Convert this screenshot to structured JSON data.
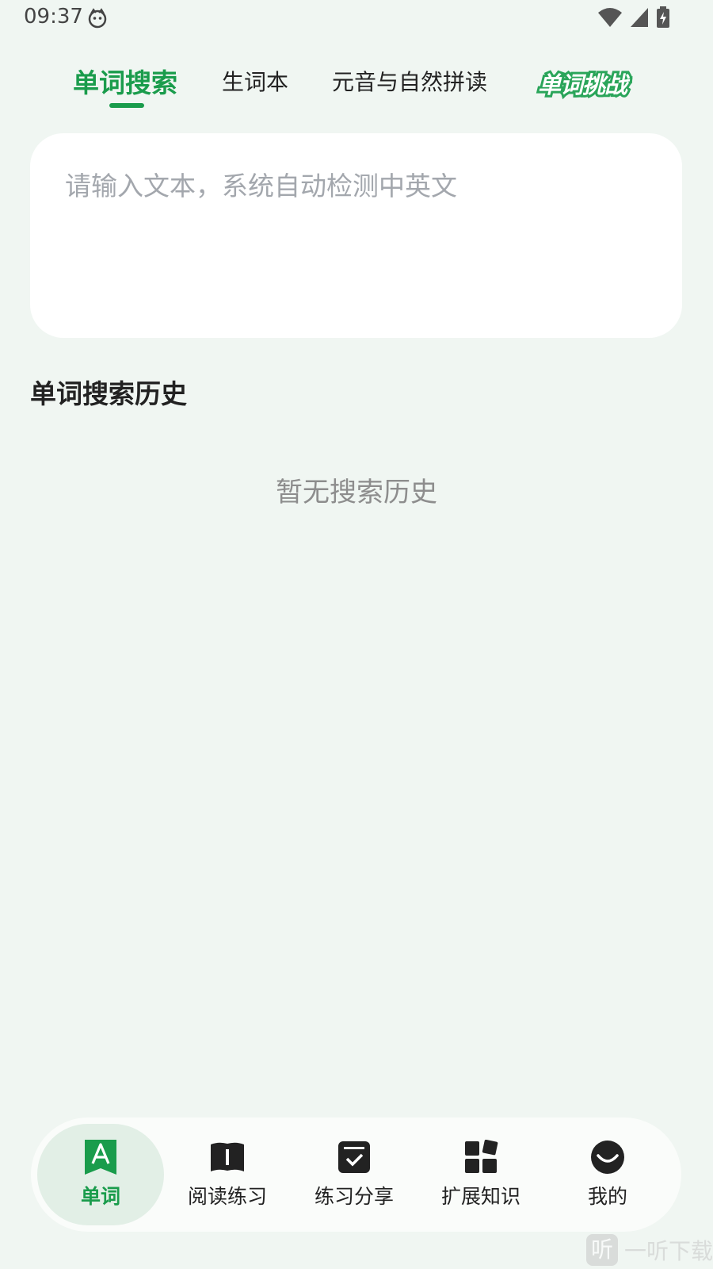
{
  "status_bar": {
    "time": "09:37"
  },
  "top_tabs": {
    "items": [
      "单词搜索",
      "生词本",
      "元音与自然拼读"
    ],
    "challenge": "单词挑战"
  },
  "search": {
    "placeholder": "请输入文本，系统自动检测中英文"
  },
  "history": {
    "title": "单词搜索历史",
    "empty_text": "暂无搜索历史"
  },
  "bottom_nav": {
    "items": [
      {
        "label": "单词",
        "icon": "word-book-icon"
      },
      {
        "label": "阅读练习",
        "icon": "reading-book-icon"
      },
      {
        "label": "练习分享",
        "icon": "checklist-icon"
      },
      {
        "label": "扩展知识",
        "icon": "blocks-icon"
      },
      {
        "label": "我的",
        "icon": "smile-face-icon"
      }
    ]
  },
  "watermark": {
    "icon_char": "听",
    "text": "一听下载"
  },
  "colors": {
    "accent": "#1a9c4c",
    "background": "#f0f6f2"
  }
}
